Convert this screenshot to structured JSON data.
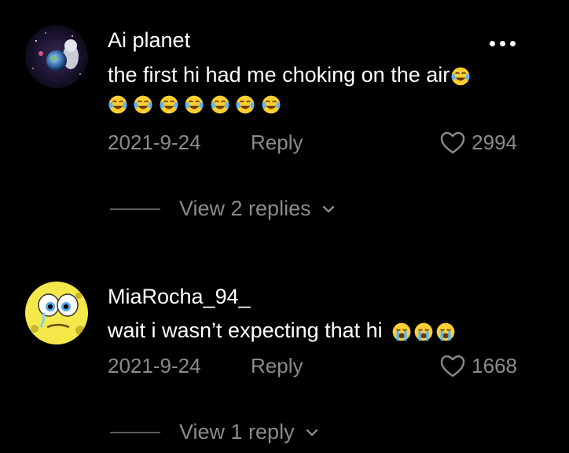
{
  "comments": [
    {
      "username": "Ai planet",
      "text": "the first hi had me choking on the air",
      "date": "2021-9-24",
      "reply_label": "Reply",
      "likes": "2994",
      "view_replies": "View 2 replies",
      "trailing_emoji": "face-with-tears-of-joy",
      "emoji_row": [
        "face-with-tears-of-joy",
        "face-with-tears-of-joy",
        "face-with-tears-of-joy",
        "face-with-tears-of-joy",
        "face-with-tears-of-joy",
        "face-with-tears-of-joy",
        "face-with-tears-of-joy"
      ]
    },
    {
      "username": "MiaRocha_94_",
      "text": "wait i wasn’t expecting that hi",
      "date": "2021-9-24",
      "reply_label": "Reply",
      "likes": "1668",
      "view_replies": "View 1 reply",
      "emoji_row": [
        "loudly-crying-face",
        "loudly-crying-face",
        "loudly-crying-face"
      ]
    }
  ],
  "colors": {
    "background": "#000000",
    "primary_text": "#ffffff",
    "secondary_text": "#8a8a8f"
  }
}
